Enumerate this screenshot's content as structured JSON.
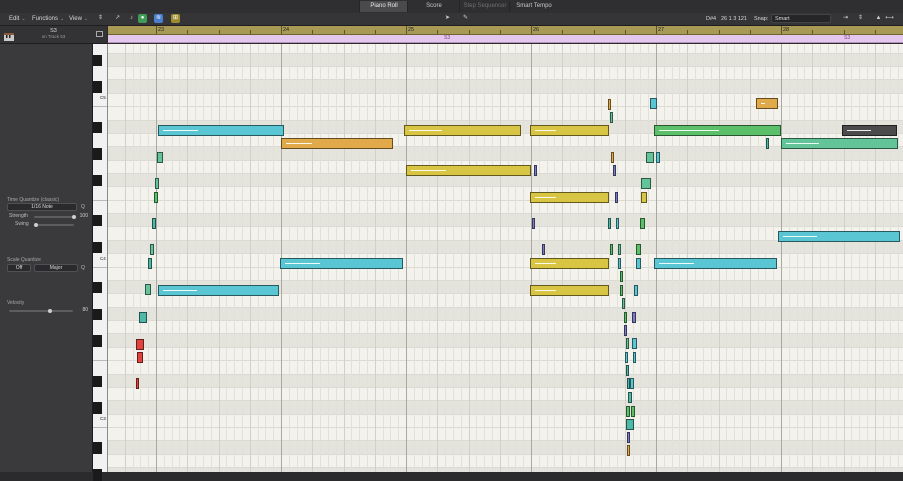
{
  "tabs": [
    "Piano Roll",
    "Score",
    "Step Sequencer",
    "Smart Tempo"
  ],
  "menus": [
    "Edit",
    "Functions",
    "View"
  ],
  "position_readout": {
    "pitch": "D#4",
    "position": "26 1 3 121"
  },
  "snap": {
    "label": "Snap:",
    "value": "Smart"
  },
  "region": {
    "name": "S3",
    "subtitle": "on Track 63"
  },
  "time_quantize": {
    "title": "Time Quantize (classic)",
    "value": "1/16 Note",
    "key": "Q",
    "strength_label": "Strength",
    "strength_value": "100",
    "strength_level": 1.0,
    "swing_label": "Swing",
    "swing_level": 0.0
  },
  "scale_quantize": {
    "title": "Scale Quantize",
    "mode": "Off",
    "scale": "Major",
    "key": "Q"
  },
  "velocity": {
    "title": "Velocity",
    "value": "80",
    "level": 0.63
  },
  "ruler": {
    "bars": [
      "23",
      "24",
      "25",
      "26",
      "27",
      "28"
    ]
  },
  "region_strip": {
    "labels": [
      "S3",
      "S3"
    ]
  },
  "keyboard": {
    "octave_labels": [
      "C5",
      "C4",
      "C3"
    ]
  },
  "colors": {
    "cyan": "#5ac6d3",
    "orange": "#e0a94a",
    "yellow": "#d8c544",
    "green": "#5cc06a",
    "seafoam": "#63c49a",
    "red": "#e0433e",
    "purple": "#7a7bc6",
    "teal": "#4fb9a8",
    "charcoal": "#4b4b4b",
    "ruler": "#a89a55",
    "region_strip": "#e5c6ec"
  }
}
